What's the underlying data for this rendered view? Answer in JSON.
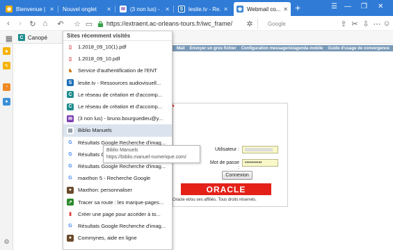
{
  "tabs": [
    {
      "title": "Bienvenue | ...",
      "icon": "globe-icon"
    },
    {
      "title": "Nouvel onglet",
      "icon": "blank-icon"
    },
    {
      "title": "(3 non lus) - ...",
      "icon": "mail-icon"
    },
    {
      "title": "lesite.tv - Re...",
      "icon": "lesite-icon"
    },
    {
      "title": "Webmail co...",
      "icon": "globe-icon"
    }
  ],
  "toolbar": {
    "url": "https://extraent.ac-orleans-tours.fr/iwc_frame/",
    "search_placeholder": "Google"
  },
  "bookmarks": [
    {
      "label": "Canopé",
      "icon": "C"
    }
  ],
  "dropdown": {
    "heading": "Sites récemment visités",
    "items": [
      {
        "label": "1.2018_09_10(1).pdf",
        "icon": "pdf-icon"
      },
      {
        "label": "1.2018_09_10.pdf",
        "icon": "pdf-icon"
      },
      {
        "label": "Service d'authentification de l'ENT",
        "icon": "ent-icon"
      },
      {
        "label": "lesite.tv - Ressources audiovisuell...",
        "icon": "lesite-icon"
      },
      {
        "label": "Le réseau de création et d'accomp...",
        "icon": "canope-icon"
      },
      {
        "label": "Le réseau de création et d'accomp...",
        "icon": "canope-icon"
      },
      {
        "label": "(3 non lus) - bruno.bourguedieu@y...",
        "icon": "mail-icon"
      },
      {
        "label": "Biblio Manuels",
        "icon": "book-icon"
      },
      {
        "label": "Résultats Google Recherche d'imag...",
        "icon": "google-icon"
      },
      {
        "label": "Résultats Go",
        "icon": "google-icon"
      },
      {
        "label": "Résultats Google Recherche d'imag...",
        "icon": "google-icon"
      },
      {
        "label": "maxthon 5 - Recherche Google",
        "icon": "google-icon"
      },
      {
        "label": "Maxthon: personnaliser",
        "icon": "maxthon-icon"
      },
      {
        "label": "Tracer sa route : les marque-pages...",
        "icon": "route-icon"
      },
      {
        "label": "Créer une page pour accéder à to...",
        "icon": "chart-icon"
      },
      {
        "label": "Résultats Google Recherche d'imag...",
        "icon": "google-icon"
      },
      {
        "label": "Commynes, aide en ligne",
        "icon": "maxthon-icon"
      }
    ],
    "highlighted_index": 7
  },
  "tooltip": {
    "title": "Biblio Manuels",
    "url": "https://biblio.manuel-numerique.com/"
  },
  "page": {
    "nav_links": [
      "Mail",
      "Envoyer un gros fichier",
      "Configuration messagerie/agenda mobile",
      "Guide d'usage de convergence"
    ],
    "user_label": "Utilisateur :",
    "password_label": "Mot de passe :",
    "password_value": "••••••••••",
    "connect_button": "Connexion",
    "oracle_logo": "ORACLE",
    "copyright": "Oracle et/ou ses affiliés. Tous droits réservés."
  }
}
